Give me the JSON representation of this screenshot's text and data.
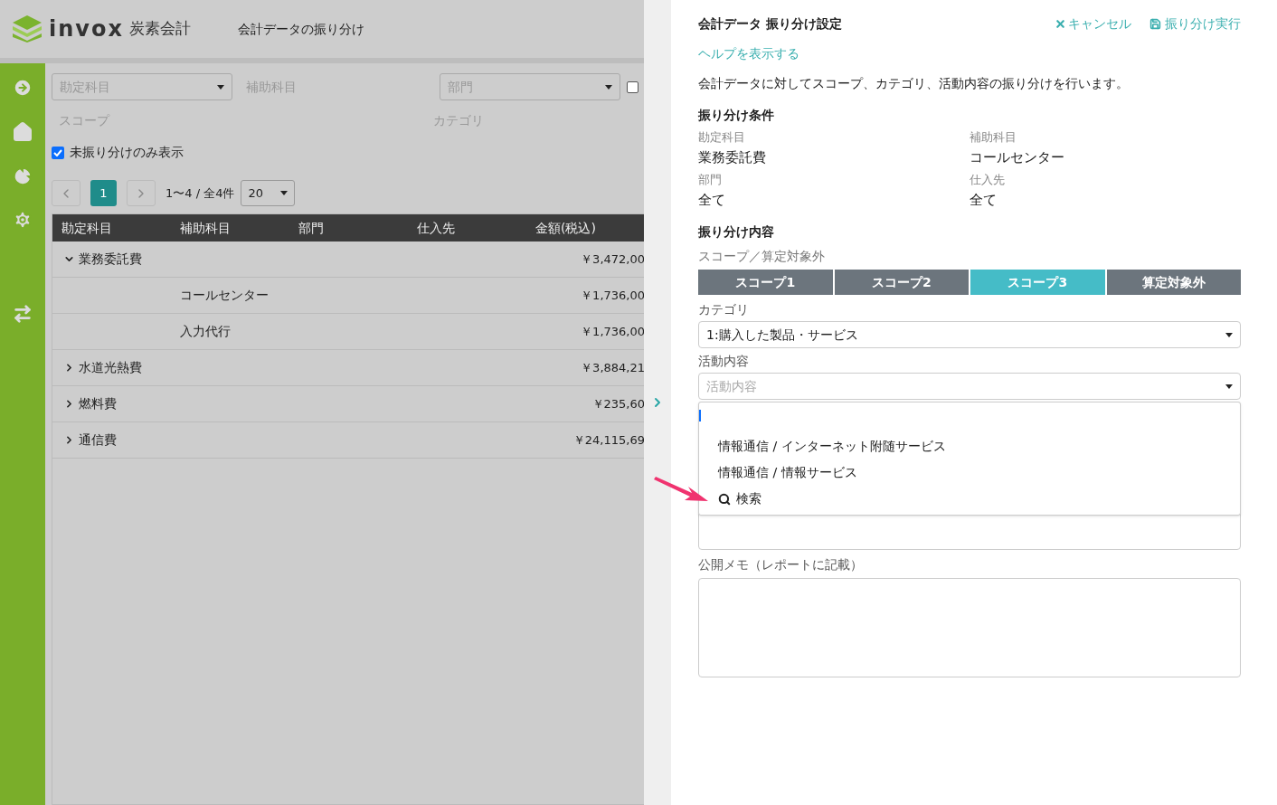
{
  "header": {
    "logo_word": "invox",
    "logo_suffix": "炭素会計",
    "page_title": "会計データの振り分け"
  },
  "filters": {
    "account_placeholder": "勘定科目",
    "sub_account_label": "補助科目",
    "department_placeholder": "部門",
    "scope_label": "スコープ",
    "category_label": "カテゴリ",
    "extra_checkbox_checked": false,
    "unassigned_only": {
      "label": "未振り分けのみ表示",
      "checked": true
    }
  },
  "pagination": {
    "pages": [
      {
        "label": "1",
        "selected": true
      }
    ],
    "range": "1〜4 / 全4件",
    "page_size": "20"
  },
  "table": {
    "columns": [
      "勘定科目",
      "補助科目",
      "部門",
      "仕入先",
      "金額(税込)"
    ],
    "rows": [
      {
        "kind": "group",
        "expanded": true,
        "account": "業務委託費",
        "amount": "￥3,472,00"
      },
      {
        "kind": "child",
        "sub_account": "コールセンター",
        "amount": "￥1,736,00"
      },
      {
        "kind": "child",
        "sub_account": "入力代行",
        "amount": "￥1,736,00"
      },
      {
        "kind": "group",
        "expanded": false,
        "account": "水道光熱費",
        "amount": "￥3,884,21"
      },
      {
        "kind": "group",
        "expanded": false,
        "account": "燃料費",
        "amount": "￥235,60"
      },
      {
        "kind": "group",
        "expanded": false,
        "account": "通信費",
        "amount": "￥24,115,69"
      }
    ]
  },
  "panel": {
    "title": "会計データ 振り分け設定",
    "cancel": "キャンセル",
    "execute": "振り分け実行",
    "help_link": "ヘルプを表示する",
    "description": "会計データに対してスコープ、カテゴリ、活動内容の振り分けを行います。",
    "conditions_heading": "振り分け条件",
    "conditions": [
      {
        "label": "勘定科目",
        "value": "業務委託費"
      },
      {
        "label": "補助科目",
        "value": "コールセンター"
      },
      {
        "label": "部門",
        "value": "全て"
      },
      {
        "label": "仕入先",
        "value": "全て"
      }
    ],
    "content_heading": "振り分け内容",
    "scope_label": "スコープ／算定対象外",
    "scopes": [
      {
        "label": "スコープ1",
        "selected": false
      },
      {
        "label": "スコープ2",
        "selected": false
      },
      {
        "label": "スコープ3",
        "selected": true
      },
      {
        "label": "算定対象外",
        "selected": false
      }
    ],
    "category_label": "カテゴリ",
    "category_value": "1:購入した製品・サービス",
    "activity_label": "活動内容",
    "activity_placeholder": "活動内容",
    "activity_options": [
      {
        "kind": "option",
        "label": "情報通信 / インターネット附随サービス"
      },
      {
        "kind": "option",
        "label": "情報通信 / 情報サービス"
      },
      {
        "kind": "search",
        "label": "検索"
      }
    ],
    "public_memo_label": "公開メモ（レポートに記載）"
  }
}
